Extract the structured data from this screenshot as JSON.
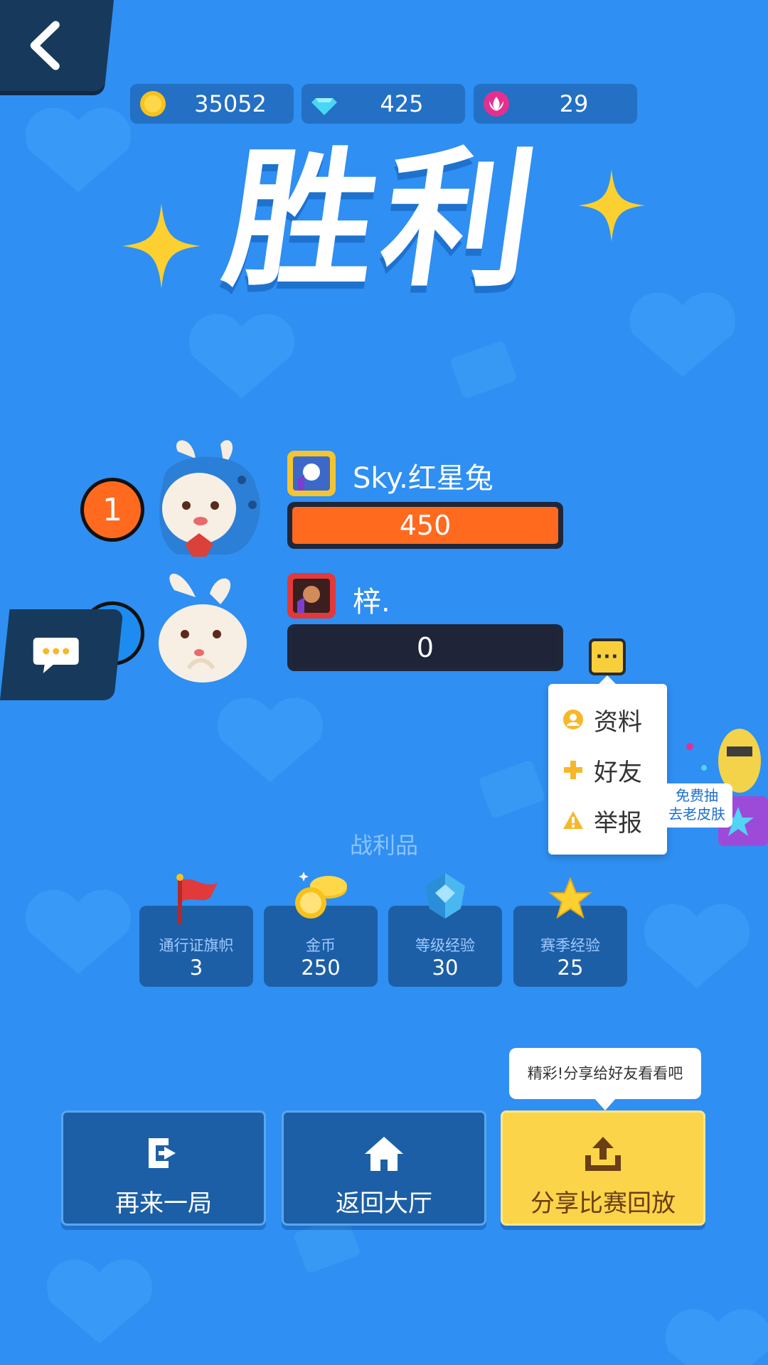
{
  "currencies": [
    {
      "name": "gold-coin-icon",
      "value": "35052"
    },
    {
      "name": "diamond-icon",
      "value": "425"
    },
    {
      "name": "lotus-icon",
      "value": "29"
    }
  ],
  "title": "胜利",
  "players": [
    {
      "rank": "1",
      "name": "Sky.红星兔",
      "score": "450",
      "bar_color": "#ff6a1f"
    },
    {
      "rank": "2",
      "name": "梓.",
      "score": "0",
      "bar_color": "#1f2438"
    }
  ],
  "more_button": "···",
  "player_menu": [
    {
      "label": "资料",
      "icon": "profile-icon"
    },
    {
      "label": "好友",
      "icon": "plus-icon"
    },
    {
      "label": "举报",
      "icon": "warning-icon"
    }
  ],
  "side_promo": {
    "line1": "免费抽",
    "line2": "去老皮肤"
  },
  "loot": {
    "title": "战利品",
    "items": [
      {
        "label": "通行证旗帜",
        "value": "3",
        "icon": "flag-icon"
      },
      {
        "label": "金币",
        "value": "250",
        "icon": "coins-icon"
      },
      {
        "label": "等级经验",
        "value": "30",
        "icon": "crystal-icon"
      },
      {
        "label": "赛季经验",
        "value": "25",
        "icon": "star-icon"
      }
    ]
  },
  "tooltip": "精彩!分享给好友看看吧",
  "actions": [
    {
      "label": "再来一局",
      "icon": "replay-icon"
    },
    {
      "label": "返回大厅",
      "icon": "home-icon"
    },
    {
      "label": "分享比赛回放",
      "icon": "share-icon"
    }
  ],
  "colors": {
    "background": "#2f8ff2",
    "rank1": "#ff6a1f",
    "rank2": "#1d8cf0",
    "accent_yellow": "#fbd44a"
  }
}
